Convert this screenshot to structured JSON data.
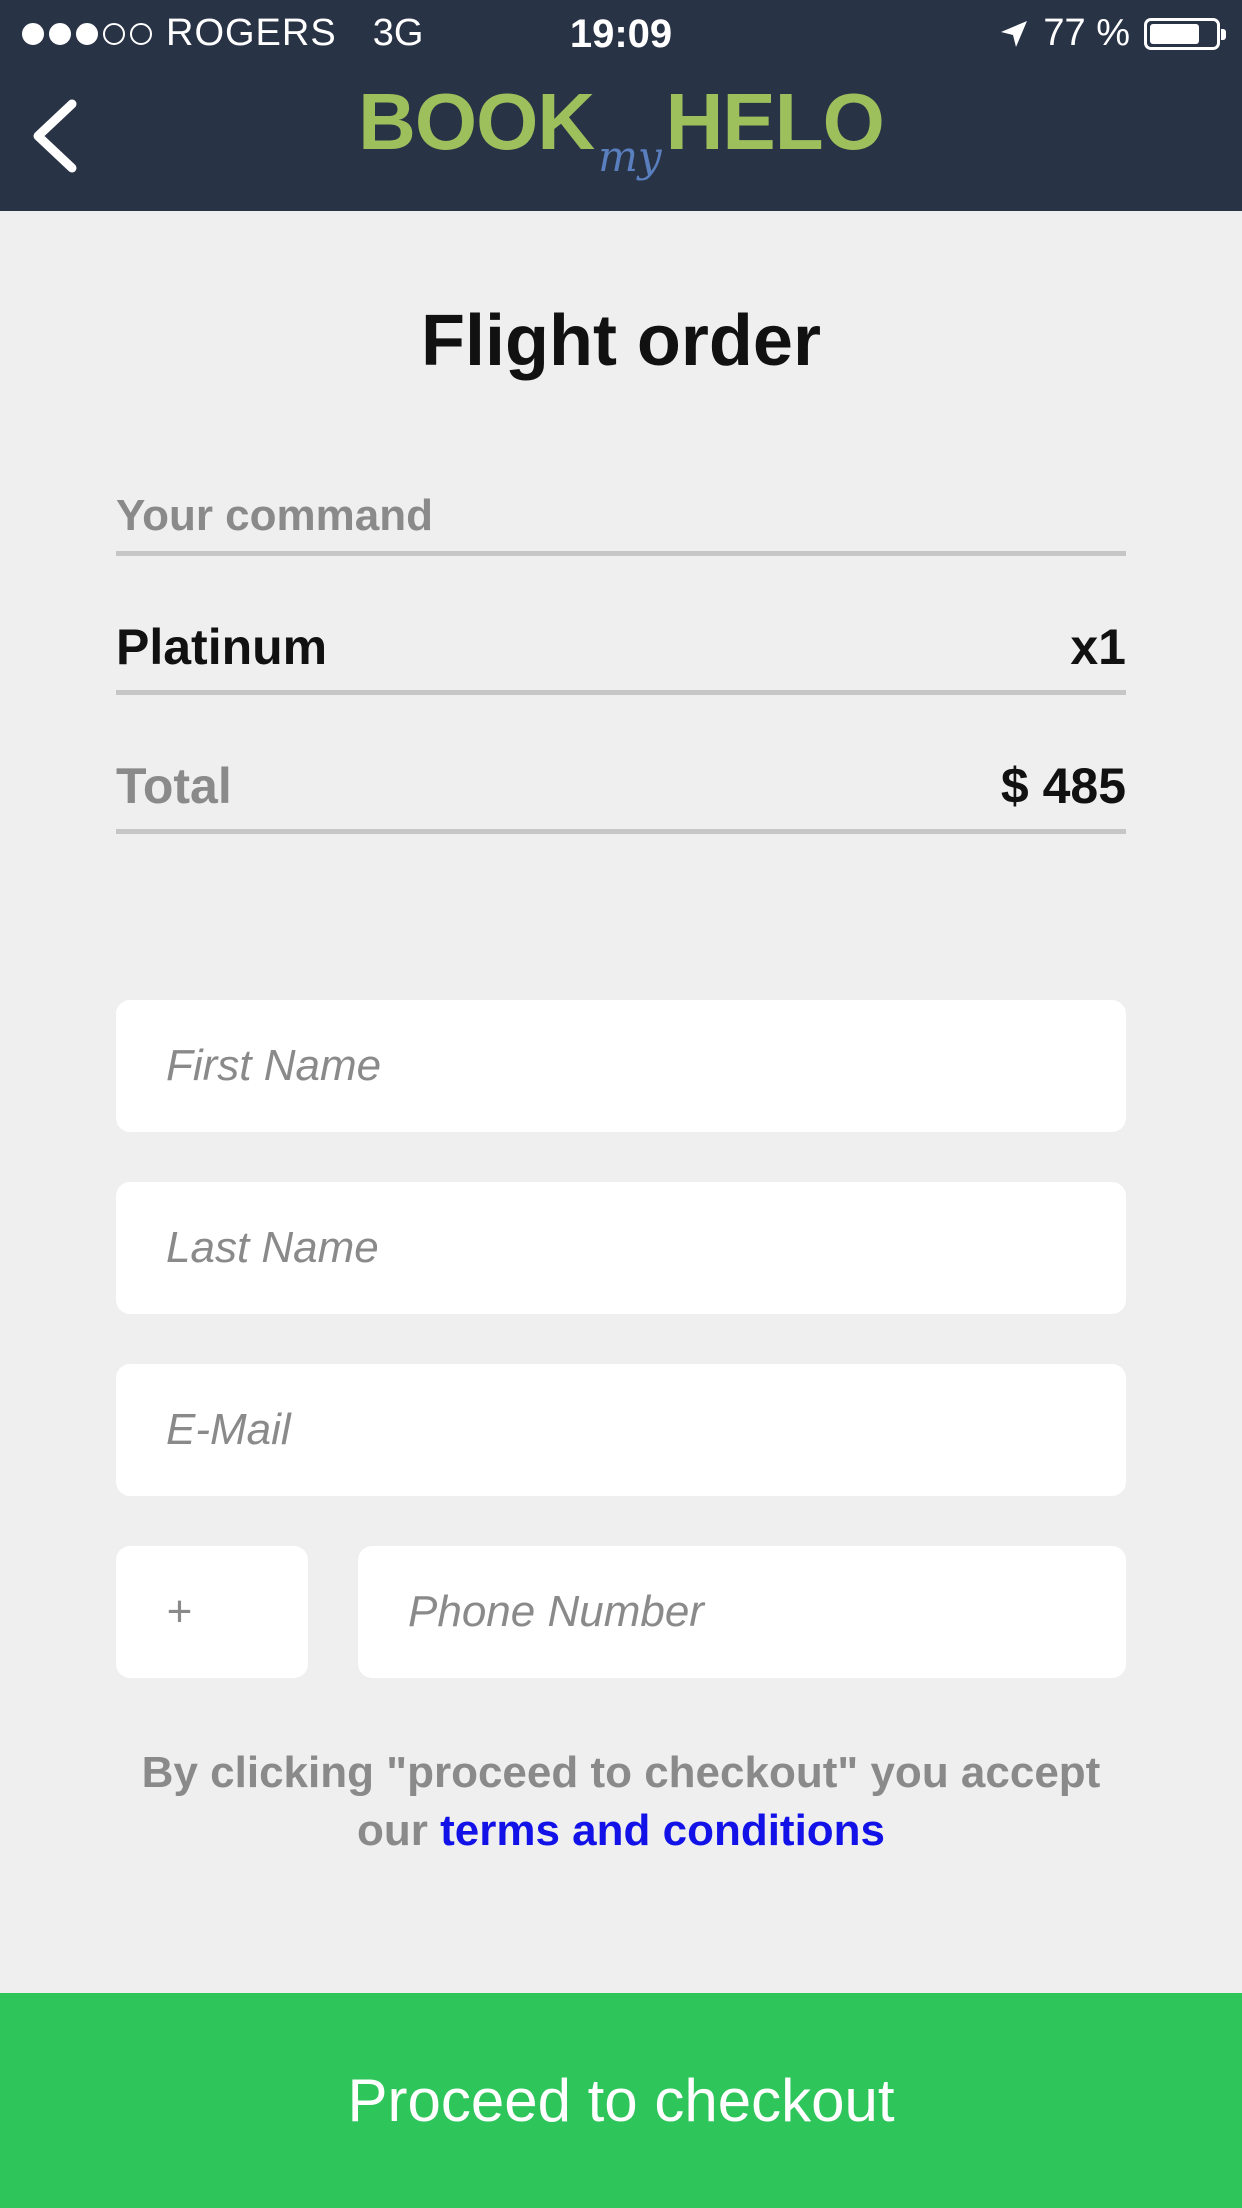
{
  "status_bar": {
    "carrier": "ROGERS",
    "network": "3G",
    "time": "19:09",
    "battery_text": "77 %",
    "battery_level": 0.77,
    "signal_bars": 3,
    "signal_total": 5
  },
  "header": {
    "logo_left": "BOOK",
    "logo_mid": "my",
    "logo_right": "HELO",
    "back_icon": "chevron-left-icon"
  },
  "page_title": "Flight order",
  "summary": {
    "command_label": "Your command",
    "item_name": "Platinum",
    "item_qty": "x1",
    "total_label": "Total",
    "total_value": "$ 485"
  },
  "form": {
    "first_name_placeholder": "First Name",
    "last_name_placeholder": "Last Name",
    "email_placeholder": "E-Mail",
    "country_code_placeholder": "+",
    "phone_placeholder": "Phone Number"
  },
  "terms": {
    "prefix": "By clicking \"proceed to checkout\" you accept our ",
    "link": "terms and conditions"
  },
  "checkout_label": "Proceed to checkout",
  "colors": {
    "header_bg": "#293346",
    "logo_green": "#9dbf5c",
    "logo_blue": "#5a7fbf",
    "checkout_green": "#2ec55a",
    "link_blue": "#1212e8"
  }
}
